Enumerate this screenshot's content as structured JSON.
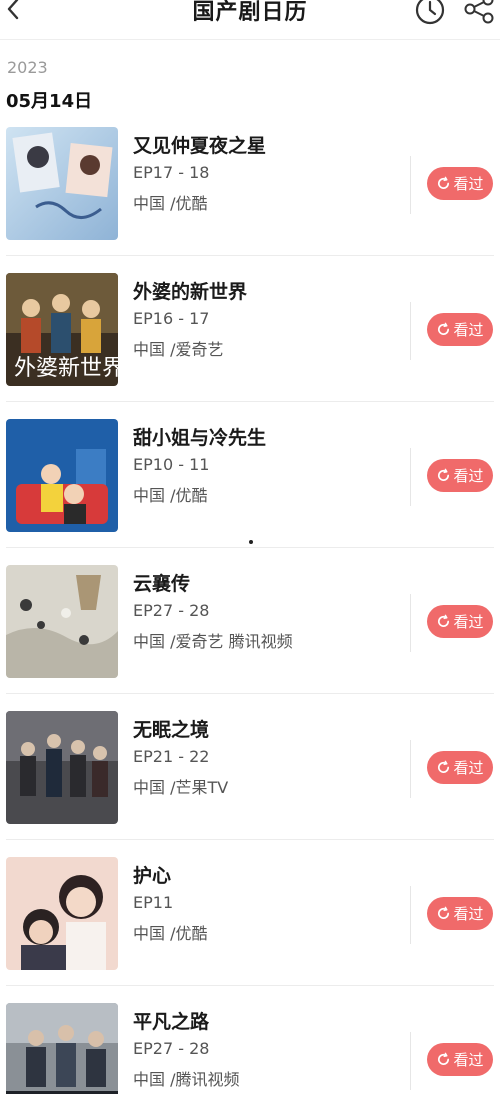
{
  "header": {
    "title": "国产剧日历",
    "back_icon": "chevron-left-icon",
    "history_icon": "clock-icon",
    "share_icon": "share-icon"
  },
  "year": "2023",
  "date": "05月14日",
  "accent_color": "#f06a6a",
  "shows": [
    {
      "title": "又见仲夏夜之星",
      "episodes": "EP17 - 18",
      "platform": "中国 /优酷",
      "button": "看过"
    },
    {
      "title": "外婆的新世界",
      "episodes": "EP16 - 17",
      "platform": "中国 /爱奇艺",
      "button": "看过"
    },
    {
      "title": "甜小姐与冷先生",
      "episodes": "EP10 - 11",
      "platform": "中国 /优酷",
      "button": "看过"
    },
    {
      "title": "云襄传",
      "episodes": "EP27 - 28",
      "platform": "中国 /爱奇艺 腾讯视频",
      "button": "看过"
    },
    {
      "title": "无眠之境",
      "episodes": "EP21 - 22",
      "platform": "中国 /芒果TV",
      "button": "看过"
    },
    {
      "title": "护心",
      "episodes": "EP11",
      "platform": "中国 /优酷",
      "button": "看过"
    },
    {
      "title": "平凡之路",
      "episodes": "EP27 - 28",
      "platform": "中国 /腾讯视频",
      "button": "看过"
    }
  ]
}
